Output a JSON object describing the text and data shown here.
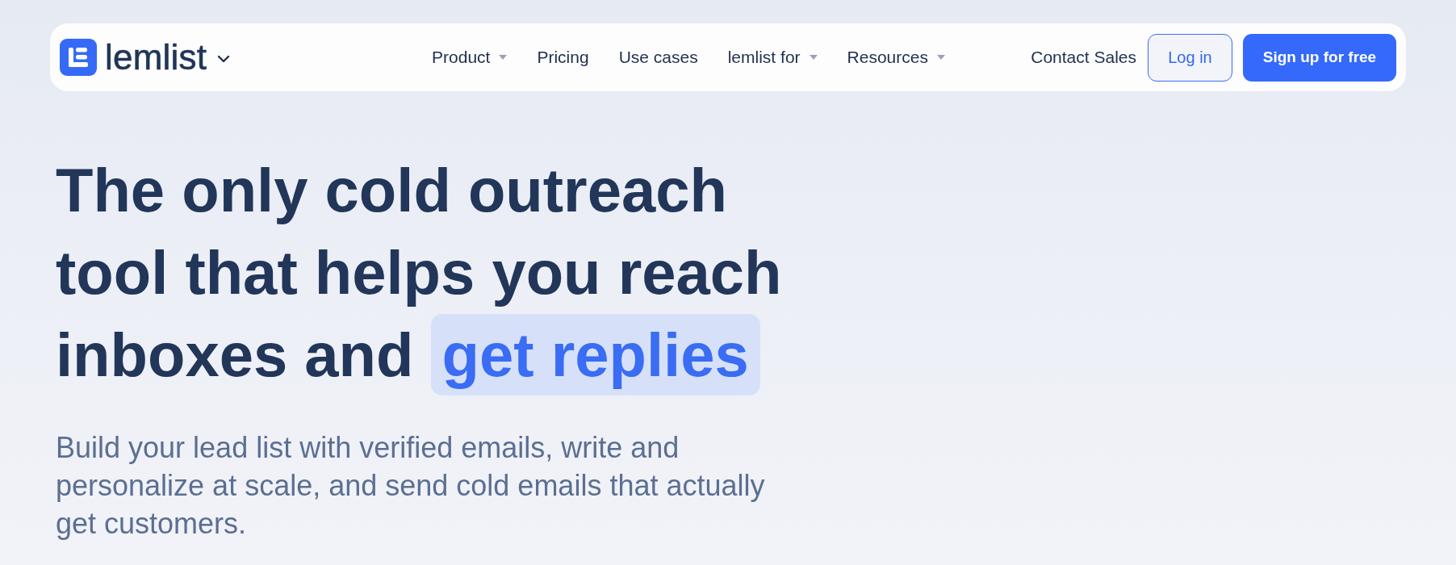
{
  "nav": {
    "brand": {
      "name": "lemlist"
    },
    "links": [
      {
        "label": "Product",
        "dropdown": true
      },
      {
        "label": "Pricing",
        "dropdown": false
      },
      {
        "label": "Use cases",
        "dropdown": false
      },
      {
        "label": "lemlist for",
        "dropdown": true
      },
      {
        "label": "Resources",
        "dropdown": true
      }
    ],
    "contact": {
      "label": "Contact Sales"
    },
    "buttons": [
      {
        "label": "Log in",
        "kind": "outline"
      },
      {
        "label": "Sign up for free",
        "kind": "primary"
      }
    ]
  },
  "hero": {
    "headline": "The only cold outreach tool that helps you reach inboxes and",
    "highlight": "get replies",
    "subtitle": "Build your lead list with verified emails, write and personalize at scale, and send cold emails that actually get customers."
  }
}
